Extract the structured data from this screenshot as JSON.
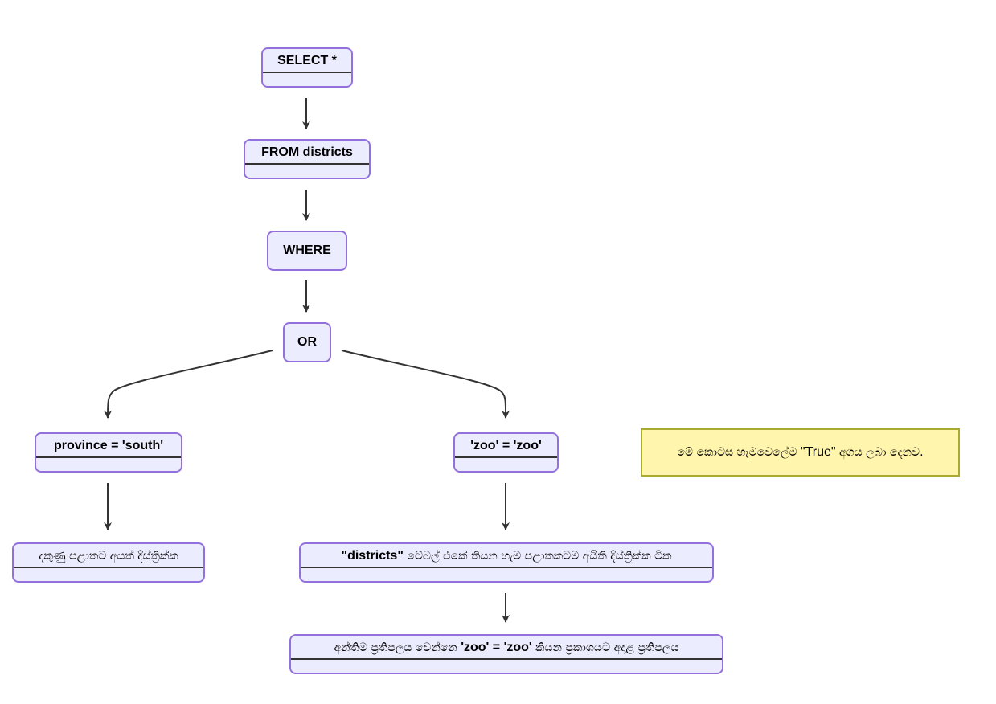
{
  "diagram": {
    "type": "state-flow",
    "colors": {
      "node_fill": "#ECECFF",
      "node_border": "#9370DB",
      "divider": "#333333",
      "edge": "#333333",
      "note_fill": "#FFF5AD",
      "note_border": "#AAAA33"
    },
    "nodes": {
      "select": {
        "label": "SELECT *"
      },
      "from": {
        "label": "FROM districts"
      },
      "where": {
        "label": "WHERE"
      },
      "or": {
        "label": "OR"
      },
      "province": {
        "label": "province = 'south'"
      },
      "zoo": {
        "label": "'zoo' = 'zoo'"
      },
      "south_result": {
        "label": "දකුණු පළාතට අයත් දිස්ත්‍රික්ක"
      },
      "all_districts": {
        "label_bold": "\"districts\"",
        "label_rest": " ටේබල් එකේ තියන හැම පළාතකටම අයිති දිස්ත්‍රික්ක ටික"
      },
      "final": {
        "label_pre": "අන්තිම ප්‍රතිපලය වෙන්නෙ ",
        "label_bold": "'zoo' = 'zoo'",
        "label_post": " කියන ප්‍රකාශයට අදාළ ප්‍රතිපලය"
      }
    },
    "note": {
      "text_pre": "මේ කොටස හැමවෙලේම ",
      "text_quote": "\"True\"",
      "text_post": " අගය ලබා දෙනව."
    },
    "edges": [
      {
        "from": "select",
        "to": "from"
      },
      {
        "from": "from",
        "to": "where"
      },
      {
        "from": "where",
        "to": "or"
      },
      {
        "from": "or",
        "to": "province"
      },
      {
        "from": "or",
        "to": "zoo"
      },
      {
        "from": "province",
        "to": "south_result"
      },
      {
        "from": "zoo",
        "to": "all_districts"
      },
      {
        "from": "all_districts",
        "to": "final"
      }
    ]
  }
}
